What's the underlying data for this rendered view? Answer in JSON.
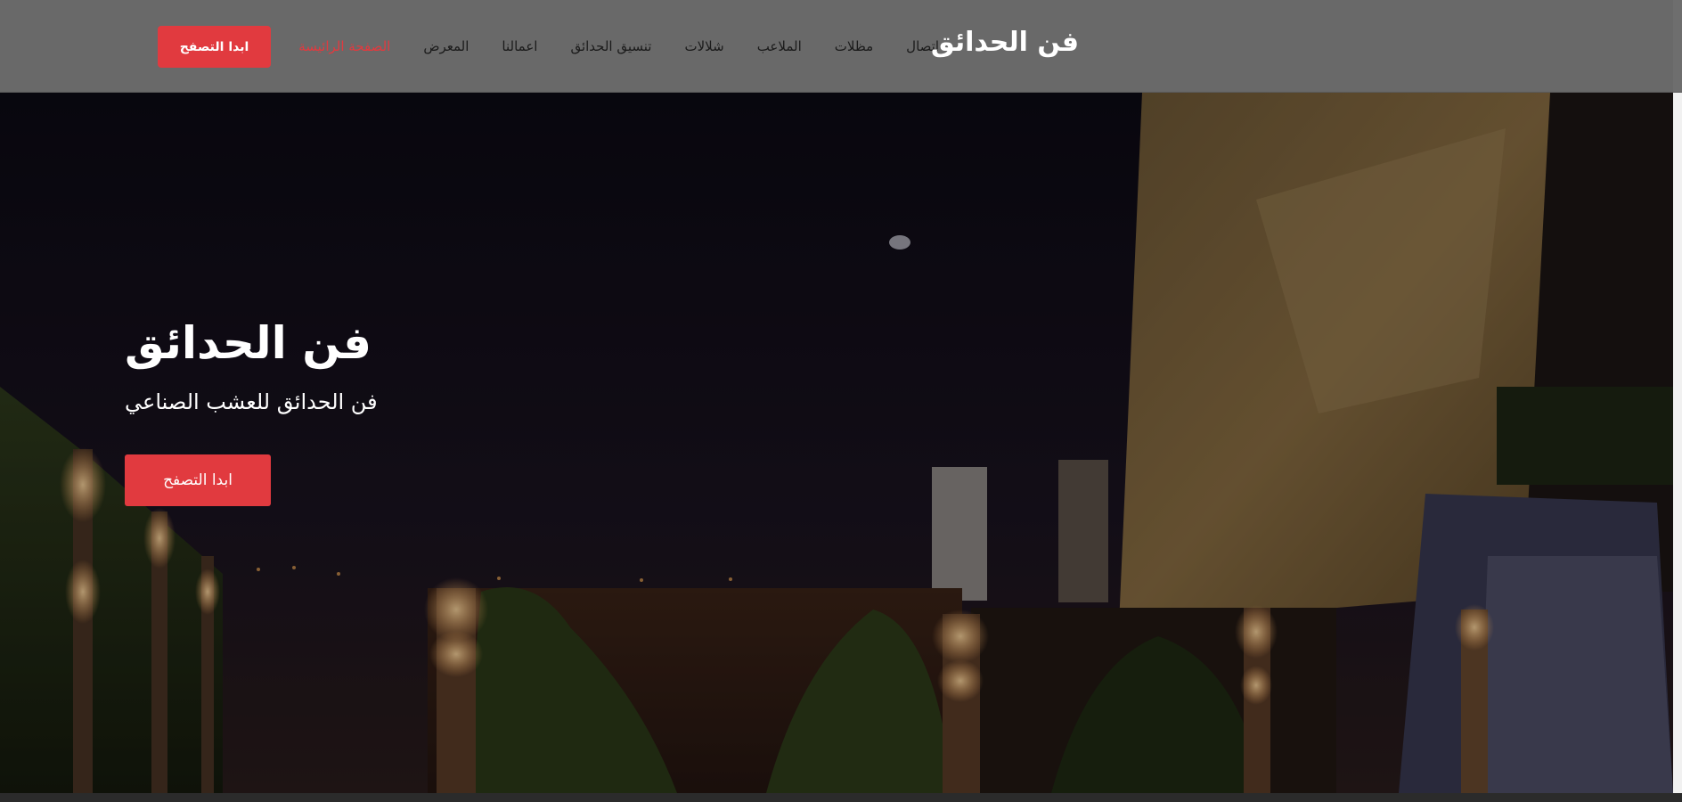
{
  "header": {
    "brand": "فن الحدائق",
    "cta_label": "ابدا التصفح",
    "nav": [
      {
        "label": "الصفحة الرائيسة",
        "active": true
      },
      {
        "label": "المعرض"
      },
      {
        "label": "اعمالنا"
      },
      {
        "label": "تنسيق الحدائق"
      },
      {
        "label": "شلالات"
      },
      {
        "label": "الملاعب"
      },
      {
        "label": "مظلات"
      },
      {
        "label": "اتصال"
      }
    ]
  },
  "hero": {
    "title": "فن الحدائق",
    "subtitle": "فن الحدائق للعشب الصناعي",
    "cta_label": "ابدا التصفح"
  },
  "colors": {
    "accent": "#e13a3f",
    "header_bg": "#696969",
    "nav_text": "#1b1b1b"
  }
}
